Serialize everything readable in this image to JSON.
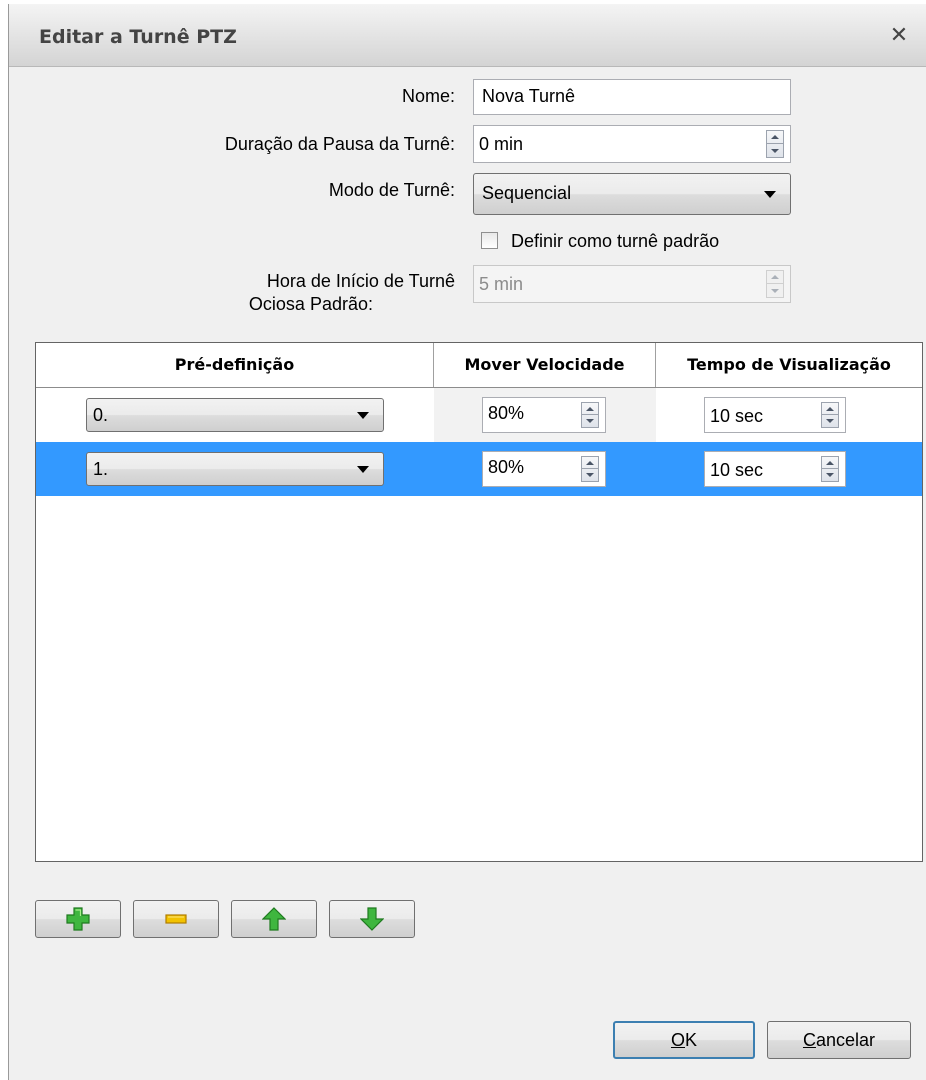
{
  "dialog": {
    "title": "Editar a Turnê PTZ",
    "close_glyph": "✕"
  },
  "form": {
    "name_label": "Nome:",
    "name_value": "Nova Turnê",
    "pause_label": "Duração da Pausa da Turnê:",
    "pause_value": "0 min",
    "mode_label": "Modo de Turnê:",
    "mode_value": "Sequencial",
    "default_checkbox_label": "Definir como turnê padrão",
    "default_checkbox_checked": false,
    "idle_label_line1": "Hora de Início de Turnê",
    "idle_label_line2": "Ociosa Padrão:",
    "idle_value": "5 min"
  },
  "table": {
    "columns": [
      "Pré-definição",
      "Mover Velocidade",
      "Tempo de Visualização"
    ],
    "rows": [
      {
        "preset": "0.",
        "speed": "80%",
        "dwell": "10 sec",
        "selected": false
      },
      {
        "preset": "1.",
        "speed": "80%",
        "dwell": "10 sec",
        "selected": true
      }
    ]
  },
  "toolbar": {
    "add_icon": "plus-icon",
    "remove_icon": "minus-icon",
    "up_icon": "arrow-up-icon",
    "down_icon": "arrow-down-icon"
  },
  "buttons": {
    "ok_mnemonic": "O",
    "ok_rest": "K",
    "cancel_mnemonic": "C",
    "cancel_rest": "ancelar"
  },
  "colors": {
    "selection": "#3399ff",
    "icon_green": "#3fb63f",
    "icon_yellow": "#f2c200"
  }
}
